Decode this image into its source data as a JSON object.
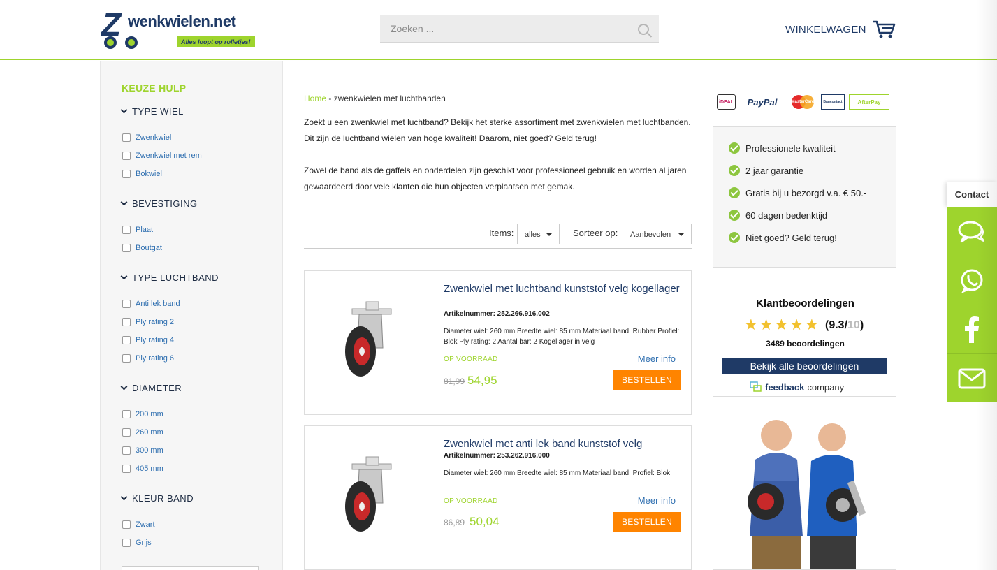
{
  "header": {
    "logo_text": "wenkwielen.net",
    "logo_tagline": "Alles loopt op rolletjes!",
    "search_placeholder": "Zoeken ...",
    "cart_label": "WINKELWAGEN"
  },
  "sidebar": {
    "title": "KEUZE HULP",
    "groups": [
      {
        "title": "TYPE WIEL",
        "options": [
          "Zwenkwiel",
          "Zwenkwiel met rem",
          "Bokwiel"
        ]
      },
      {
        "title": "BEVESTIGING",
        "options": [
          "Plaat",
          "Boutgat"
        ]
      },
      {
        "title": "TYPE LUCHTBAND",
        "options": [
          "Anti lek band",
          "Ply rating 2",
          "Ply rating 4",
          "Ply rating 6"
        ]
      },
      {
        "title": "DIAMETER",
        "options": [
          "200 mm",
          "260 mm",
          "300 mm",
          "405 mm"
        ]
      },
      {
        "title": "KLEUR BAND",
        "options": [
          "Zwart",
          "Grijs"
        ]
      }
    ]
  },
  "breadcrumb": {
    "home": "Home",
    "separator": " - ",
    "current": "zwenkwielen met luchtbanden"
  },
  "intro": {
    "p1": "Zoekt u een zwenkwiel met luchtband? Bekijk het sterke assortiment met zwenkwielen met luchtbanden. Dit zijn de luchtband wielen van hoge kwaliteit! Daarom, niet goed? Geld terug!",
    "p2": "Zowel de band als de gaffels en onderdelen zijn geschikt voor professioneel gebruik en worden al jaren gewaardeerd door vele klanten die hun objecten verplaatsen met gemak."
  },
  "controls": {
    "items_label": "Items:",
    "items_value": "alles",
    "sort_label": "Sorteer op:",
    "sort_value": "Aanbevolen"
  },
  "products": [
    {
      "title": "Zwenkwiel met luchtband kunststof velg kogellager",
      "article": "Artikelnummer: 252.266.916.002",
      "description": "Diameter wiel: 260 mm Breedte wiel: 85 mm Materiaal band: Rubber Profiel: Blok Ply rating: 2 Aantal bar: 2 Kogellager in velg",
      "stock": "OP VOORRAAD",
      "more": "Meer info",
      "old_price": "81,99",
      "new_price": "54,95",
      "button": "BESTELLEN"
    },
    {
      "title": "Zwenkwiel met anti lek band kunststof velg",
      "article": "Artikelnummer: 253.262.916.000",
      "description": "Diameter wiel: 260 mm Breedte wiel: 85 mm Materiaal band: Profiel: Blok",
      "stock": "OP VOORRAAD",
      "more": "Meer info",
      "old_price": "86,89",
      "new_price": "50,04",
      "button": "BESTELLEN"
    }
  ],
  "payments": [
    "iDEAL",
    "PayPal",
    "MasterCard",
    "Bancontact",
    "AfterPay"
  ],
  "usps": [
    "Professionele kwaliteit",
    "2 jaar garantie",
    "Gratis bij u bezorgd v.a. € 50.-",
    "60 dagen bedenktijd",
    "Niet goed? Geld terug!"
  ],
  "reviews": {
    "title": "Klantbeoordelingen",
    "score": "9.3",
    "score_max": "10",
    "count": "3489 beoordelingen",
    "button": "Bekijk alle beoordelingen",
    "provider_bold": "feedback",
    "provider_rest": "company"
  },
  "contact": {
    "label": "Contact",
    "buttons": [
      "chat-icon",
      "whatsapp-icon",
      "facebook-icon",
      "mail-icon"
    ]
  },
  "colors": {
    "brand_green": "#9ed42d",
    "brand_blue": "#1f3a66",
    "order_orange": "#ff8400",
    "link_blue": "#2f6fb0"
  }
}
